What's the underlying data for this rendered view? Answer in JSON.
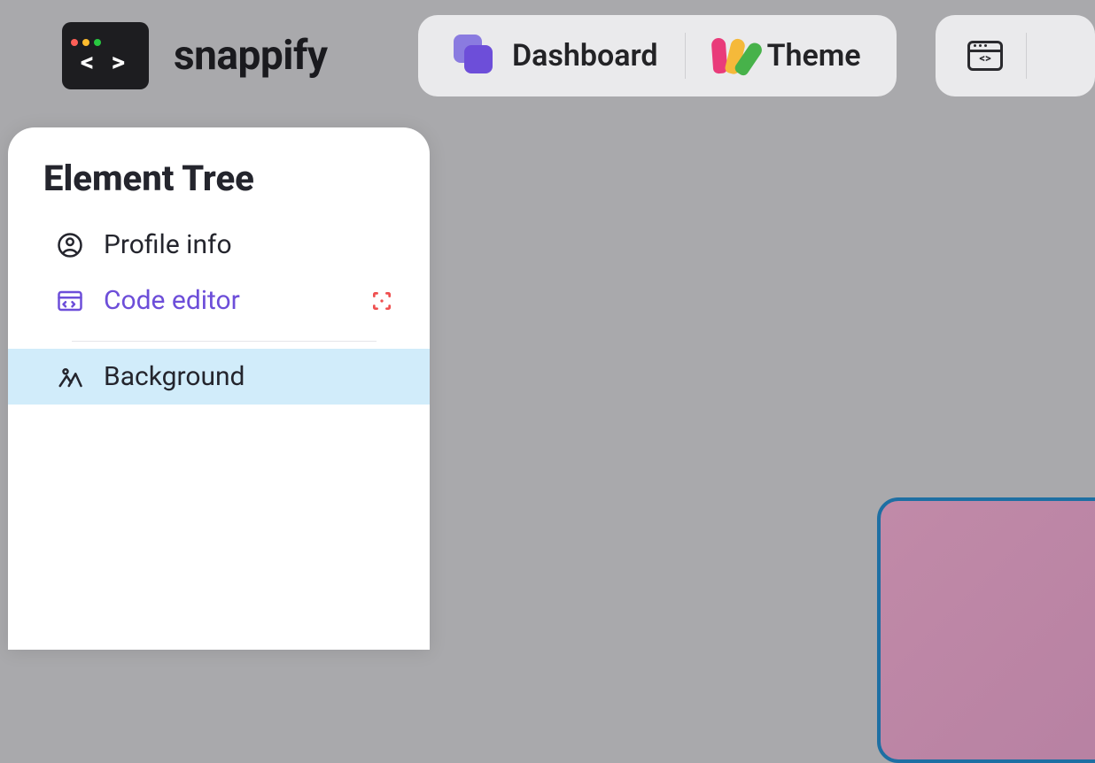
{
  "brand": "snappify",
  "nav": {
    "dashboard": "Dashboard",
    "theme": "Theme"
  },
  "panel": {
    "title": "Element Tree",
    "items": {
      "profile": "Profile info",
      "codeeditor": "Code editor",
      "background": "Background"
    }
  },
  "colors": {
    "accent": "#6d4ed9",
    "selection": "#d1ecfa",
    "canvas_border": "#1e6fa3"
  }
}
